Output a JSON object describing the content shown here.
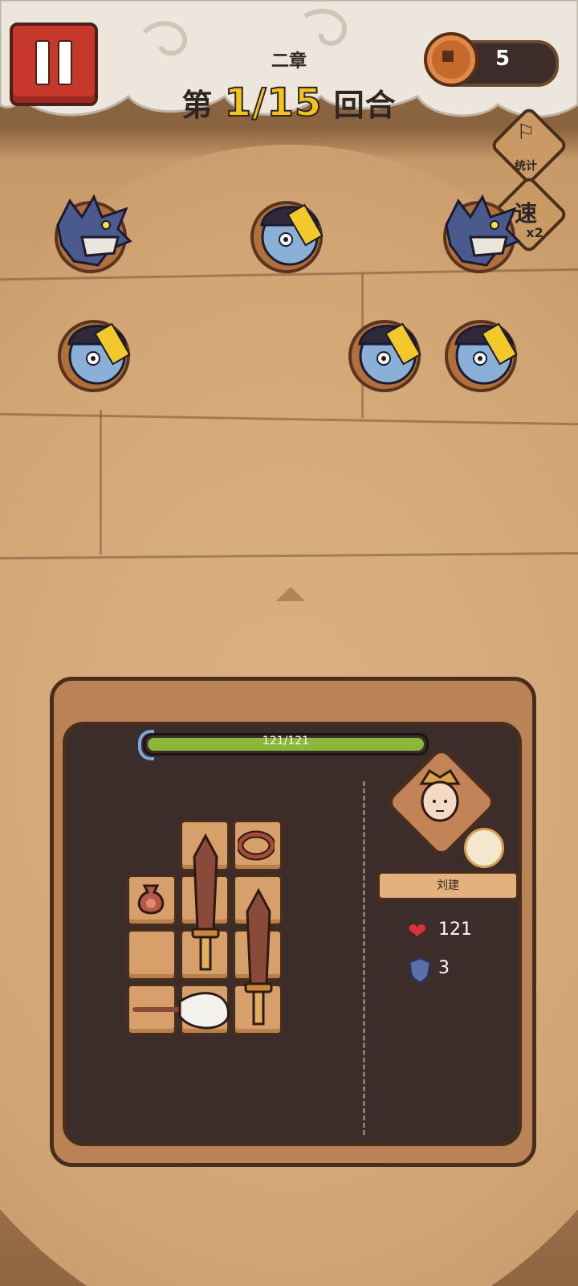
{
  "header": {
    "chapter": "二章",
    "round_prefix": "第",
    "round_value": "1/15",
    "round_suffix": "回合"
  },
  "currency": {
    "value": "5",
    "icon": "coin-icon"
  },
  "side_buttons": {
    "stats_label": "统计",
    "speed_label": "速",
    "speed_multiplier": "x2"
  },
  "enemies": [
    {
      "type": "werewolf"
    },
    {
      "type": "jiangshi"
    },
    {
      "type": "werewolf"
    },
    {
      "type": "jiangshi"
    },
    {
      "type": "jiangshi"
    },
    {
      "type": "jiangshi"
    }
  ],
  "player": {
    "hp_text": "121/121",
    "hp_fraction": 1.0,
    "name": "刘建",
    "health": "121",
    "armor": "3"
  },
  "inventory": {
    "items": [
      "sword",
      "sword",
      "ring",
      "pouch",
      "fly-whisk"
    ]
  },
  "colors": {
    "hp_green": "#8bb83a",
    "pause_red": "#c6372c",
    "round_yellow": "#f5c21a"
  }
}
